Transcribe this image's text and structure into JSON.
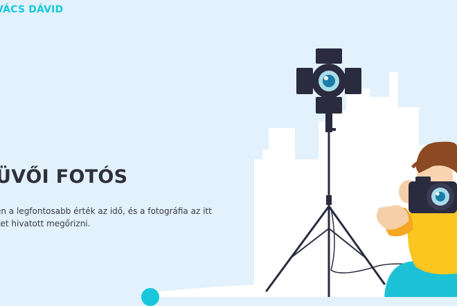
{
  "brand": {
    "logo_text": "VÁCS DÁVID"
  },
  "hero": {
    "title": "ÜVŐI FOTÓS",
    "description_line1": "en a legfontosabb érték az idő, és a fotográfia az itt",
    "description_line2": "ket hivatott megőrizni."
  },
  "illustration": {
    "icon": "photographer-with-studio-light-illustration",
    "accent_color": "#16c9de",
    "background_color": "#e2f1fc"
  }
}
